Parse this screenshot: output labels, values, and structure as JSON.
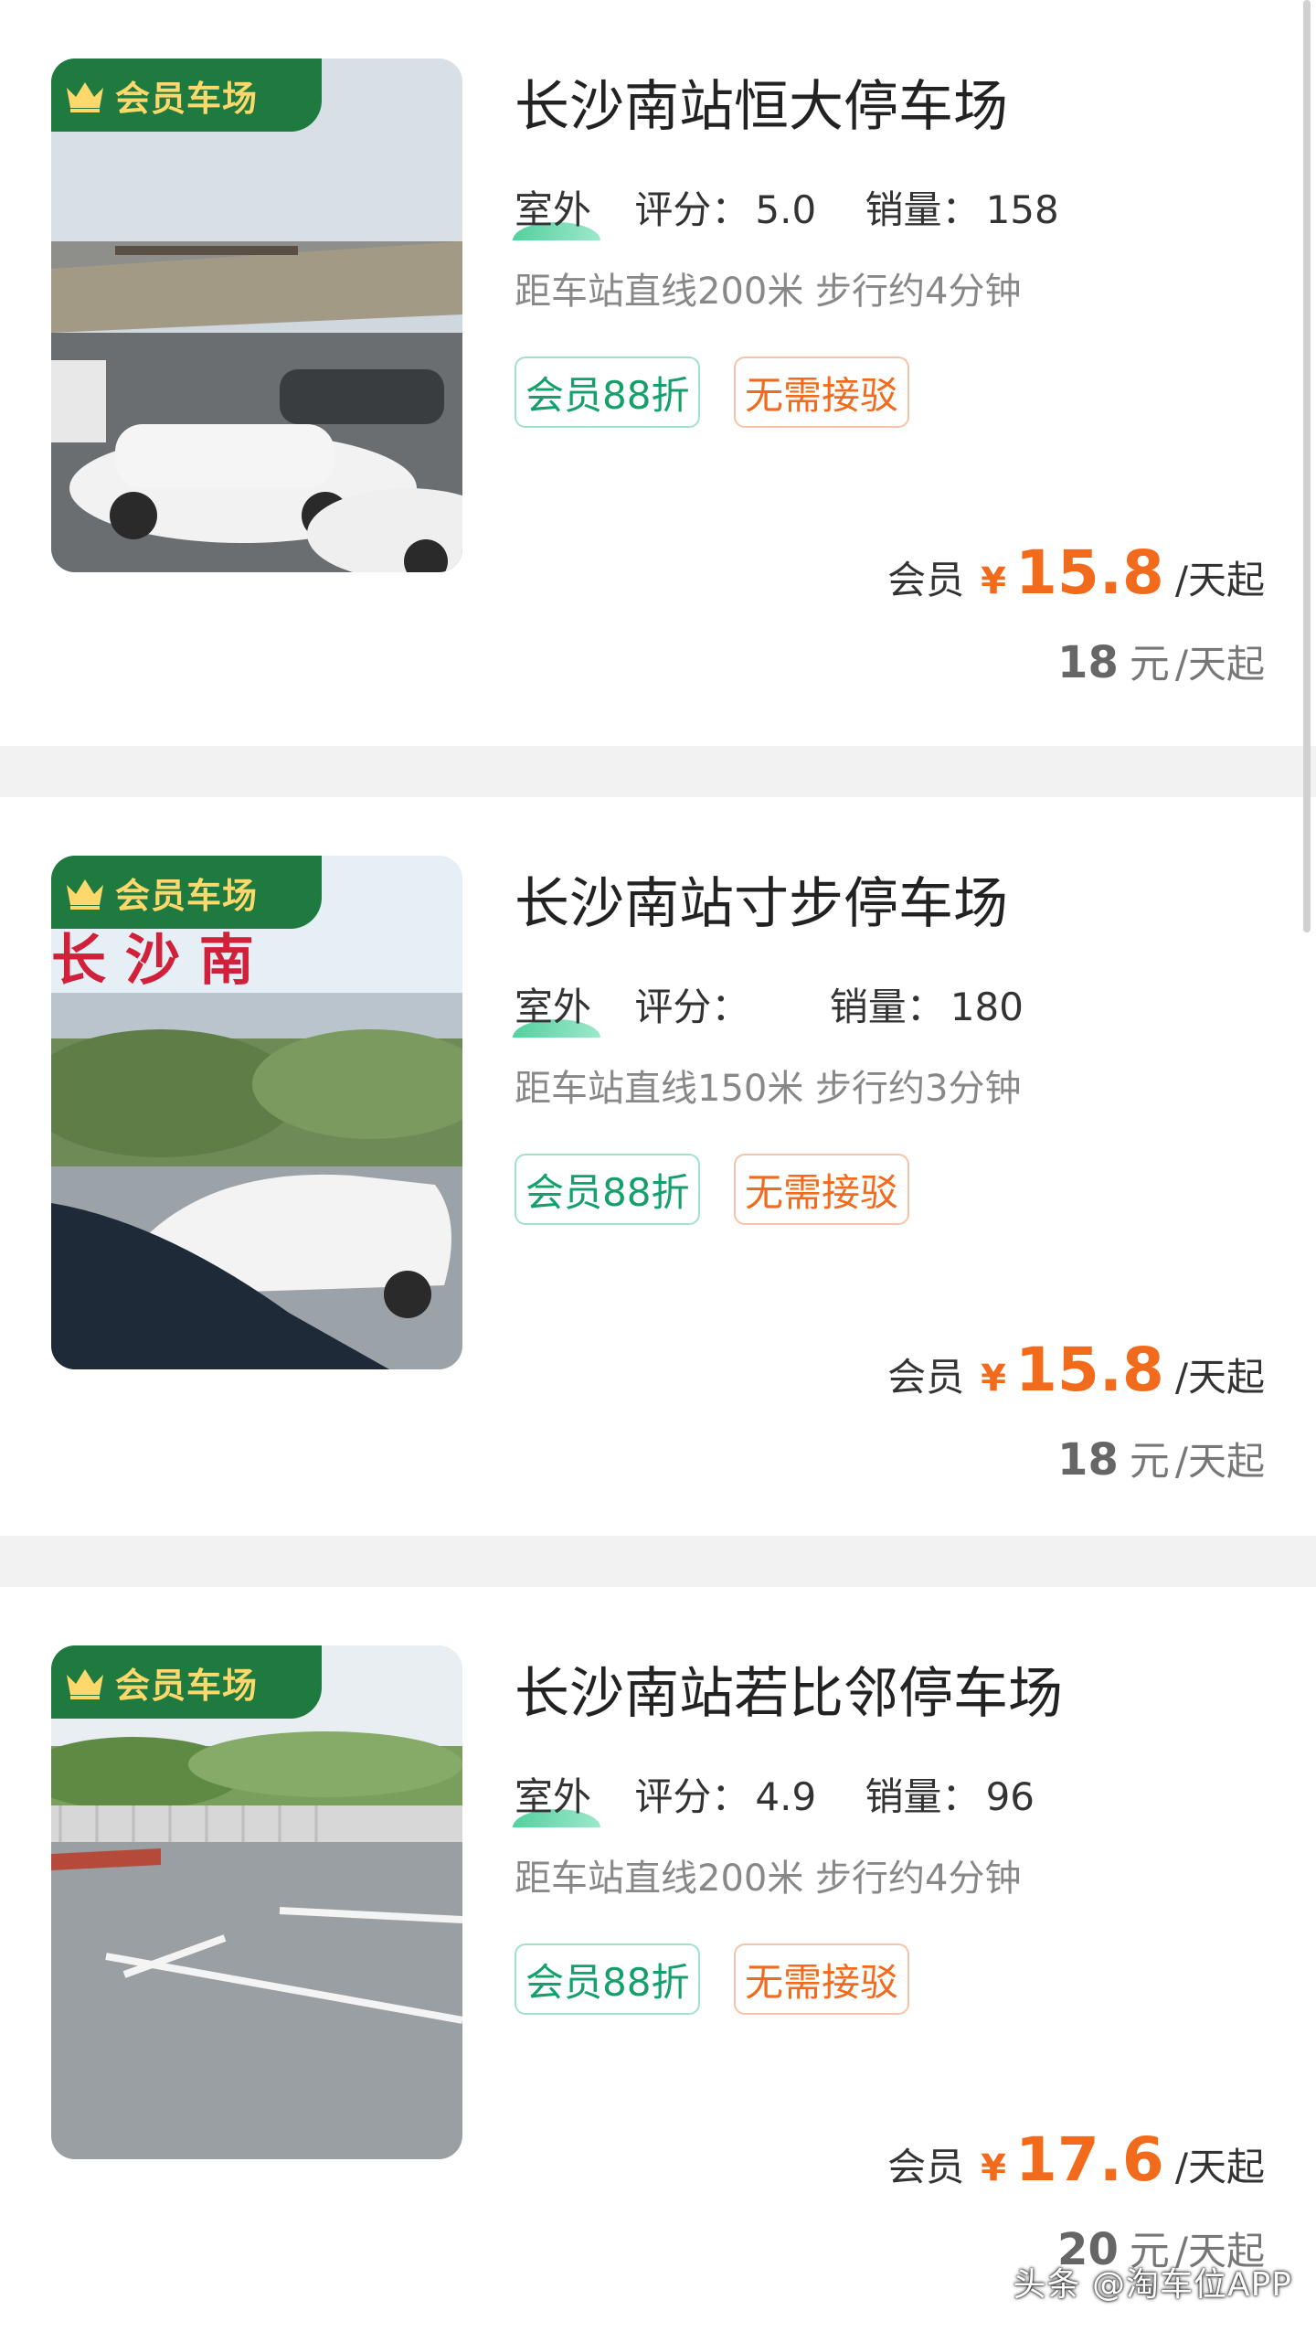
{
  "listings": [
    {
      "badge": "会员车场",
      "title": "长沙南站恒大停车场",
      "type": "室外",
      "rating_label": "评分：",
      "rating": "5.0",
      "sales_label": "销量：",
      "sales": "158",
      "distance": "距车站直线200米 步行约4分钟",
      "tags": [
        "会员88折",
        "无需接驳"
      ],
      "member_label": "会员",
      "currency": "¥",
      "member_price": "15.8",
      "unit": "/天起",
      "original_price": "18",
      "original_currency": "元",
      "original_unit": "/天起",
      "photo": "parking-lot-with-white-cars-photo"
    },
    {
      "badge": "会员车场",
      "title": "长沙南站寸步停车场",
      "type": "室外",
      "rating_label": "评分：",
      "rating": "",
      "sales_label": "销量：",
      "sales": "180",
      "distance": "距车站直线150米 步行约3分钟",
      "tags": [
        "会员88折",
        "无需接驳"
      ],
      "member_label": "会员",
      "currency": "¥",
      "member_price": "15.8",
      "unit": "/天起",
      "original_price": "18",
      "original_currency": "元",
      "original_unit": "/天起",
      "photo": "station-sign-and-cars-photo",
      "photo_sign": "长 沙 南"
    },
    {
      "badge": "会员车场",
      "title": "长沙南站若比邻停车场",
      "type": "室外",
      "rating_label": "评分：",
      "rating": "4.9",
      "sales_label": "销量：",
      "sales": "96",
      "distance": "距车站直线200米 步行约4分钟",
      "tags": [
        "会员88折",
        "无需接驳"
      ],
      "member_label": "会员",
      "currency": "¥",
      "member_price": "17.6",
      "unit": "/天起",
      "original_price": "20",
      "original_currency": "元",
      "original_unit": "/天起",
      "photo": "empty-parking-spaces-photo"
    }
  ],
  "watermark": "头条 @淘车位APP",
  "colors": {
    "accent_orange": "#f26a1b",
    "member_green": "#13a06a",
    "badge_green": "#1f7a3f",
    "badge_gold": "#ffd86b"
  }
}
